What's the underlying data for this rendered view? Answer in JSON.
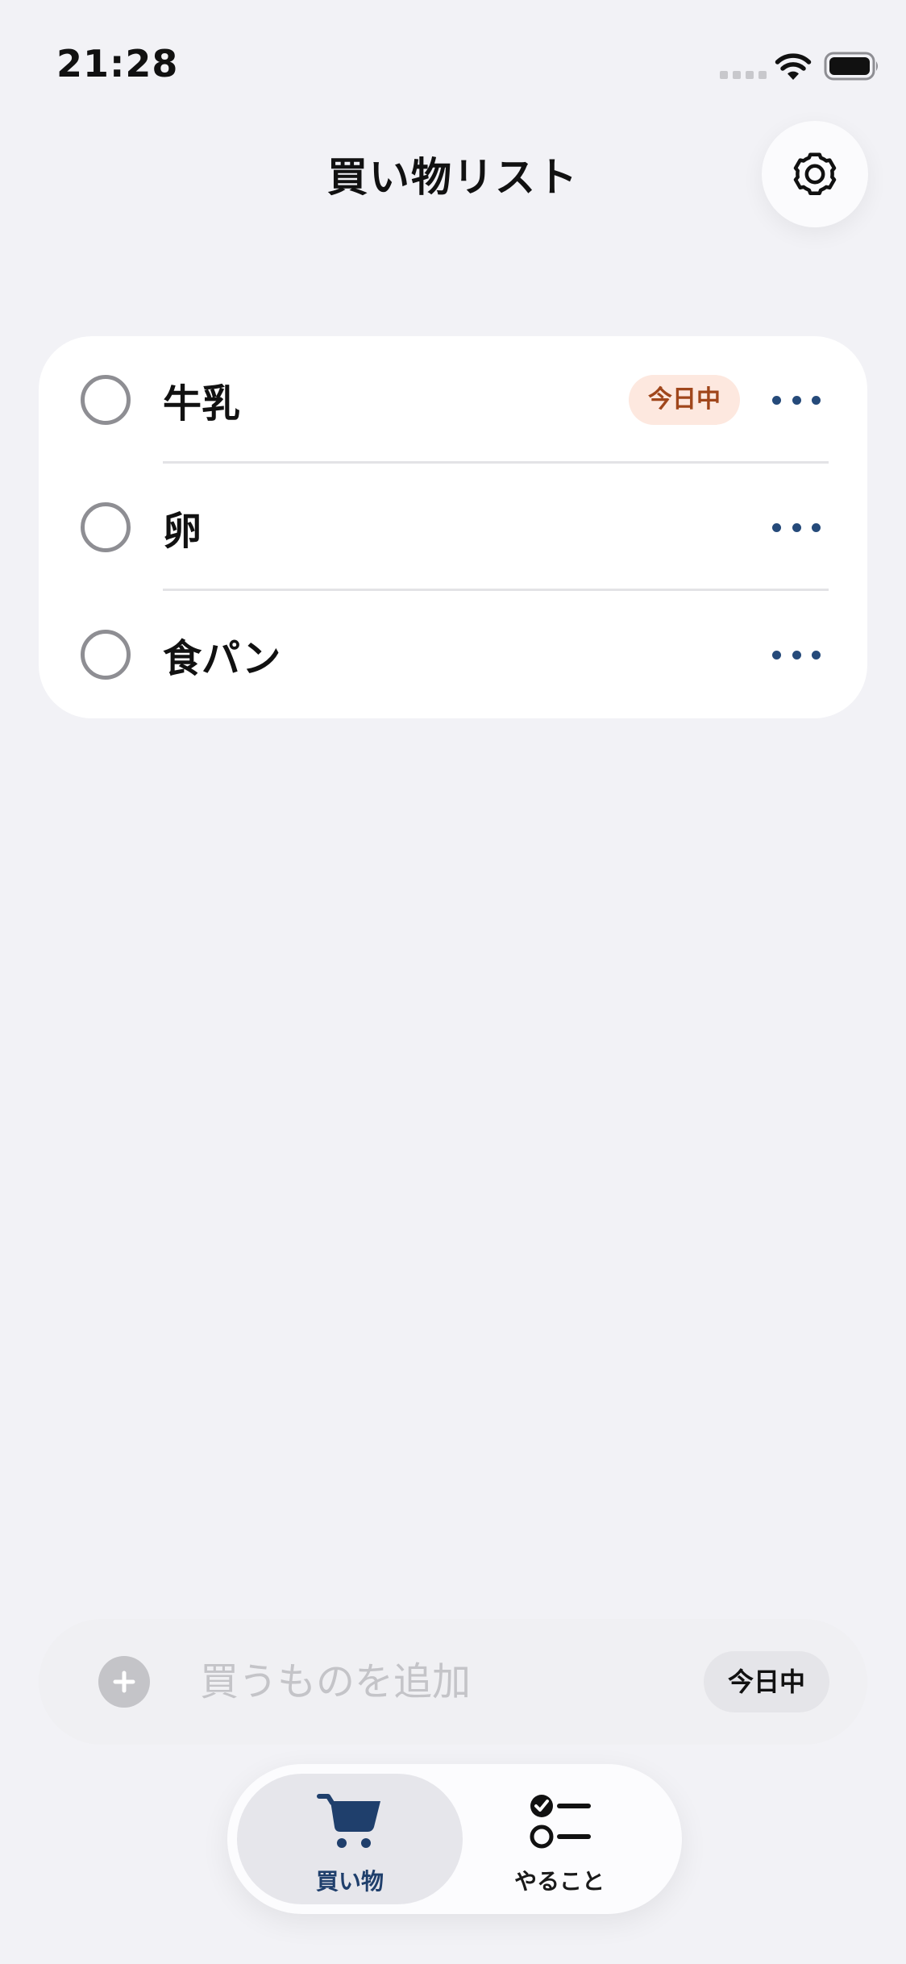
{
  "status_bar": {
    "time": "21:28",
    "icons": [
      "cellular-signal-icon",
      "wifi-icon",
      "battery-icon"
    ]
  },
  "header": {
    "title": "買い物リスト",
    "settings_icon": "gear-icon"
  },
  "items": [
    {
      "label": "牛乳",
      "badge": "今日中",
      "checked": false,
      "more_icon": "ellipsis-icon"
    },
    {
      "label": "卵",
      "badge": "",
      "checked": false,
      "more_icon": "ellipsis-icon"
    },
    {
      "label": "食パン",
      "badge": "",
      "checked": false,
      "more_icon": "ellipsis-icon"
    }
  ],
  "add_bar": {
    "add_icon": "plus-icon",
    "placeholder": "買うものを追加",
    "value": "",
    "due_label": "今日中"
  },
  "tabs": [
    {
      "label": "買い物",
      "icon": "cart-icon",
      "selected": true
    },
    {
      "label": "やること",
      "icon": "checklist-icon",
      "selected": false
    }
  ],
  "colors": {
    "background": "#f2f2f6",
    "accent": "#1f3f6c",
    "badge_background": "#fde8df",
    "badge_text": "#a0461b"
  }
}
